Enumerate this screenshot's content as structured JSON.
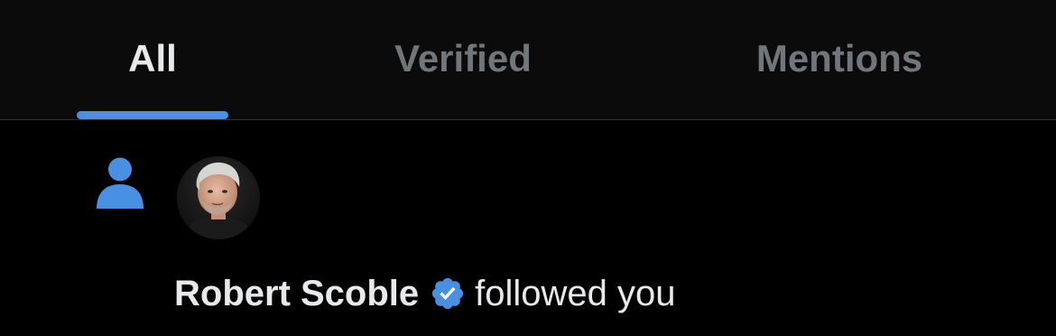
{
  "tabs": [
    {
      "label": "All",
      "active": true
    },
    {
      "label": "Verified",
      "active": false
    },
    {
      "label": "Mentions",
      "active": false
    }
  ],
  "notification": {
    "type_icon": "person-icon",
    "user_name": "Robert Scoble",
    "verified_badge_icon": "verified-badge-icon",
    "action_text": "followed you"
  },
  "colors": {
    "accent": "#4a90e2",
    "active_tab_text": "#e7e9ea",
    "inactive_tab_text": "#71767b",
    "background": "#000000",
    "tabbar_background": "#0b0b0c",
    "divider": "#2f3336"
  }
}
